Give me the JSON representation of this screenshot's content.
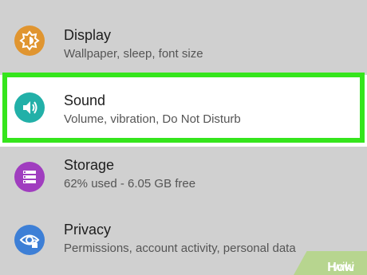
{
  "settings": {
    "items": [
      {
        "title": "Display",
        "subtitle": "Wallpaper, sleep, font size",
        "icon": "display-brightness-icon",
        "icon_color": "#e09530"
      },
      {
        "title": "Sound",
        "subtitle": "Volume, vibration, Do Not Disturb",
        "icon": "speaker-volume-icon",
        "icon_color": "#22b0a8",
        "highlighted": true
      },
      {
        "title": "Storage",
        "subtitle": "62% used - 6.05 GB free",
        "icon": "storage-stack-icon",
        "icon_color": "#a03dbf"
      },
      {
        "title": "Privacy",
        "subtitle": "Permissions, account activity, personal data",
        "icon": "privacy-eye-lock-icon",
        "icon_color": "#3d7fd6"
      }
    ]
  },
  "colors": {
    "background": "#d0d0d0",
    "highlight_background": "#ffffff",
    "highlight_border": "#35e51c"
  },
  "watermark": {
    "prefix": "wiki",
    "suffix": "How"
  }
}
